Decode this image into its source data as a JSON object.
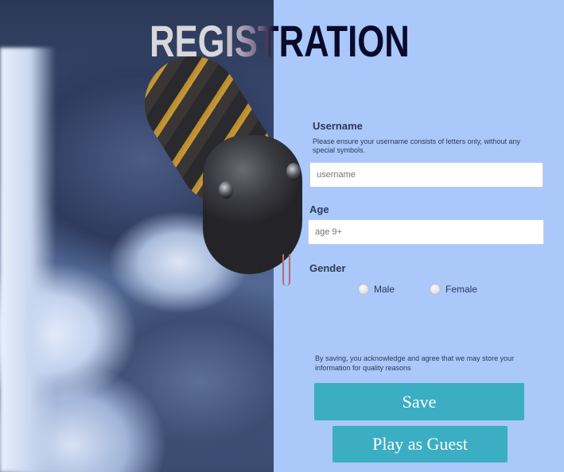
{
  "header": {
    "title": "REGISTRATION"
  },
  "form": {
    "username": {
      "label": "Username",
      "hint": "Please ensure your username consists of letters only, without any special symbols.",
      "placeholder": "username"
    },
    "age": {
      "label": "Age",
      "placeholder": "age 9+"
    },
    "gender": {
      "label": "Gender",
      "options": [
        "Male",
        "Female"
      ]
    },
    "disclaimer": "By saving, you acknowledge and agree that we may store your information for quality reasons",
    "save_label": "Save",
    "guest_label": "Play as Guest"
  },
  "colors": {
    "panel_bg": "#aac8fa",
    "button_bg": "#3baec4",
    "button_text": "#ffffff"
  }
}
